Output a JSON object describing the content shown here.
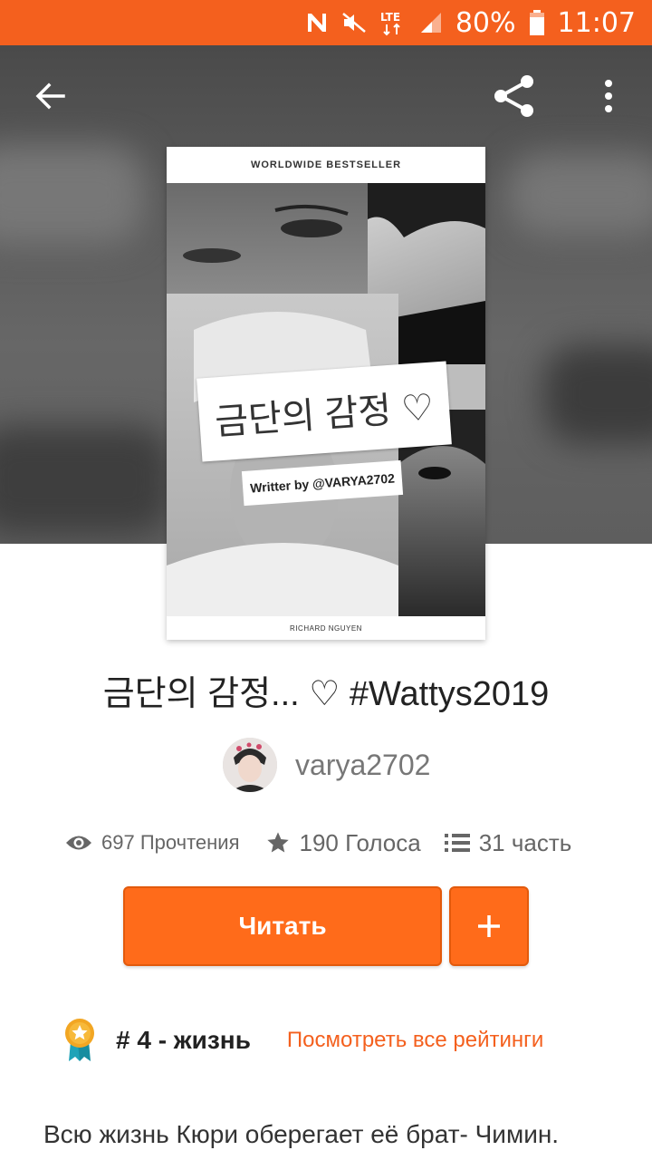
{
  "status_bar": {
    "battery": "80%",
    "time": "11:07",
    "network": "LTE",
    "icons": [
      "nfc-icon",
      "mute-icon",
      "lte-icon",
      "signal-icon",
      "battery-icon"
    ]
  },
  "cover": {
    "top_text": "WORLDWIDE BESTSELLER",
    "title_text": "금단의 감정 ♡",
    "writer_text": "Writter by @VARYA2702",
    "bottom_text": "RICHARD NGUYEN"
  },
  "story": {
    "title": "금단의 감정...  ♡   #Wattys2019",
    "author": "varya2702"
  },
  "stats": {
    "reads": "697 Прочтения",
    "votes": "190 Голоса",
    "parts": "31 часть"
  },
  "actions": {
    "read_label": "Читать"
  },
  "ranking": {
    "label": "# 4 - жизнь",
    "link": "Посмотреть все рейтинги"
  },
  "description": "Всю жизнь Кюри оберегает её брат- Чимин.",
  "colors": {
    "accent": "#FF6B1A",
    "status_bar": "#F4601E"
  }
}
